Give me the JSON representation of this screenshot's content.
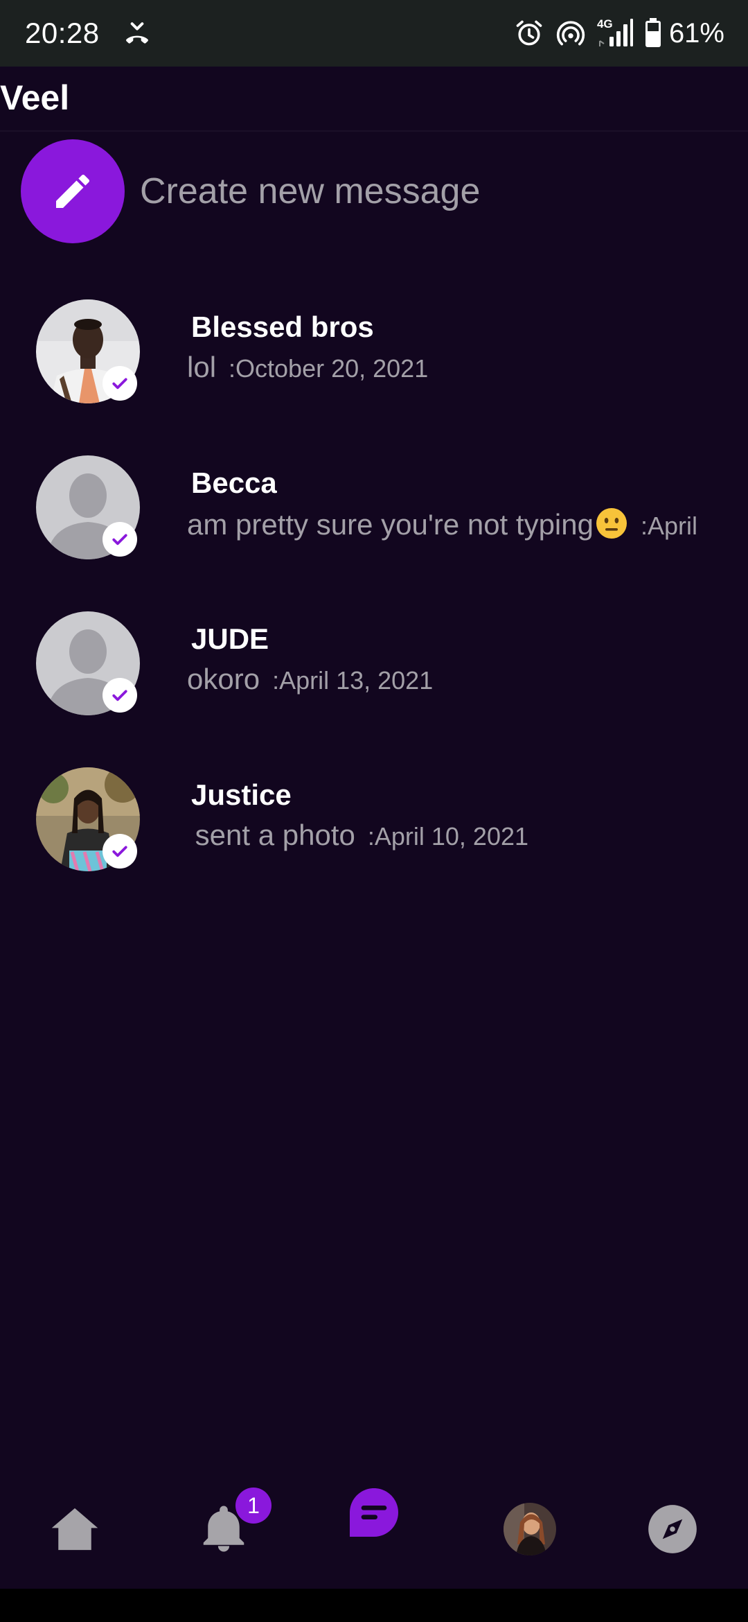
{
  "status_bar": {
    "time": "20:28",
    "network_type": "4G",
    "battery_percent": "61%",
    "icons": [
      "call-end-icon",
      "alarm-icon",
      "hotspot-icon",
      "signal-icon",
      "battery-icon"
    ]
  },
  "app": {
    "title": "Veel"
  },
  "create_message": {
    "label": "Create new message",
    "icon": "pencil-icon"
  },
  "conversations": [
    {
      "name": "Blessed bros",
      "preview": "lol",
      "date": ":October 20, 2021",
      "verified": true,
      "avatar": "photo"
    },
    {
      "name": "Becca",
      "preview": "am pretty sure you're not typing",
      "preview_emoji": "neutral-face-emoji",
      "date": ":April",
      "verified": true,
      "avatar": "default"
    },
    {
      "name": "JUDE",
      "preview": "okoro",
      "date": ":April 13, 2021",
      "verified": true,
      "avatar": "default"
    },
    {
      "name": "Justice",
      "preview": " sent a photo",
      "date": ":April 10, 2021",
      "verified": true,
      "avatar": "photo"
    }
  ],
  "bottom_nav": {
    "items": [
      "home-icon",
      "bell-icon",
      "messages-icon",
      "profile-avatar",
      "explore-icon"
    ],
    "notification_count": "1",
    "active": "messages-icon"
  },
  "colors": {
    "background": "#12061f",
    "accent": "#8a18dc",
    "muted_text": "#a3a0a8",
    "icon_grey": "#a6a4a9"
  }
}
